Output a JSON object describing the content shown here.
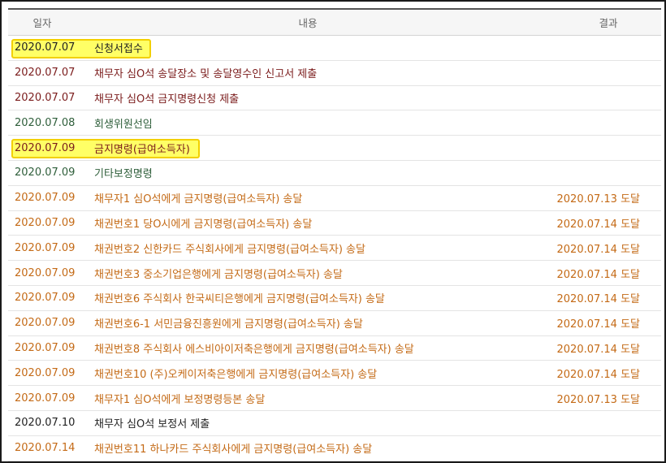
{
  "table": {
    "headers": {
      "date": "일자",
      "content": "내용",
      "result": "결과"
    },
    "rows": [
      {
        "date": "2020.07.07",
        "content": "신청서접수",
        "result": "",
        "kind": "black",
        "highlight": true,
        "hlWidth": 172
      },
      {
        "date": "2020.07.07",
        "content": "채무자 심O석 송달장소 및 송달영수인 신고서 제출",
        "result": "",
        "kind": "maroon",
        "highlight": false
      },
      {
        "date": "2020.07.07",
        "content": "채무자 심O석 금지명령신청 제출",
        "result": "",
        "kind": "maroon",
        "highlight": false
      },
      {
        "date": "2020.07.08",
        "content": "회생위원선임",
        "result": "",
        "kind": "green",
        "highlight": false
      },
      {
        "date": "2020.07.09",
        "content": "금지명령(급여소득자)",
        "result": "",
        "kind": "maroon",
        "highlight": true,
        "hlWidth": 232
      },
      {
        "date": "2020.07.09",
        "content": "기타보정명령",
        "result": "",
        "kind": "green",
        "highlight": false
      },
      {
        "date": "2020.07.09",
        "content": "채무자1 심O석에게 금지명령(급여소득자) 송달",
        "result": "2020.07.13 도달",
        "kind": "orange",
        "highlight": false
      },
      {
        "date": "2020.07.09",
        "content": "채권번호1 당O시에게 금지명령(급여소득자) 송달",
        "result": "2020.07.14 도달",
        "kind": "orange",
        "highlight": false
      },
      {
        "date": "2020.07.09",
        "content": "채권번호2 신한카드 주식회사에게 금지명령(급여소득자) 송달",
        "result": "2020.07.14 도달",
        "kind": "orange",
        "highlight": false
      },
      {
        "date": "2020.07.09",
        "content": "채권번호3 중소기업은행에게 금지명령(급여소득자) 송달",
        "result": "2020.07.14 도달",
        "kind": "orange",
        "highlight": false
      },
      {
        "date": "2020.07.09",
        "content": "채권번호6 주식회사 한국씨티은행에게 금지명령(급여소득자) 송달",
        "result": "2020.07.14 도달",
        "kind": "orange",
        "highlight": false
      },
      {
        "date": "2020.07.09",
        "content": "채권번호6-1 서민금융진흥원에게 금지명령(급여소득자) 송달",
        "result": "2020.07.14 도달",
        "kind": "orange",
        "highlight": false
      },
      {
        "date": "2020.07.09",
        "content": "채권번호8 주식회사 에스비아이저축은행에게 금지명령(급여소득자) 송달",
        "result": "2020.07.14 도달",
        "kind": "orange",
        "highlight": false
      },
      {
        "date": "2020.07.09",
        "content": "채권번호10 (주)오케이저축은행에게 금지명령(급여소득자) 송달",
        "result": "2020.07.14 도달",
        "kind": "orange",
        "highlight": false
      },
      {
        "date": "2020.07.09",
        "content": "채무자1 심O석에게 보정명령등본 송달",
        "result": "2020.07.13 도달",
        "kind": "orange",
        "highlight": false
      },
      {
        "date": "2020.07.10",
        "content": "채무자 심O석 보정서 제출",
        "result": "",
        "kind": "black",
        "highlight": false
      },
      {
        "date": "2020.07.14",
        "content": "채권번호11 하나카드 주식회사에게 금지명령(급여소득자) 송달",
        "result": "",
        "kind": "orange",
        "highlight": false
      }
    ]
  },
  "colors": {
    "black": "#222222",
    "maroon": "#7b1c1c",
    "green": "#2e5e3a",
    "orange": "#c46a16",
    "highlight": "#ffff66"
  }
}
